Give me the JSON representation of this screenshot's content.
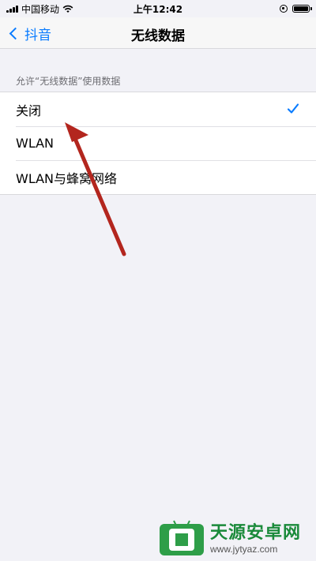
{
  "status_bar": {
    "carrier": "中国移动",
    "time": "上午12:42"
  },
  "nav": {
    "back_label": "抖音",
    "title": "无线数据"
  },
  "section": {
    "header": "允许“无线数据”使用数据"
  },
  "options": [
    {
      "label": "关闭",
      "selected": true
    },
    {
      "label": "WLAN",
      "selected": false
    },
    {
      "label": "WLAN与蜂窝网络",
      "selected": false
    }
  ],
  "colors": {
    "accent": "#0a7cff",
    "annotation_arrow": "#b3261e"
  },
  "watermark": {
    "title": "天源安卓网",
    "url": "www.jytyaz.com"
  }
}
